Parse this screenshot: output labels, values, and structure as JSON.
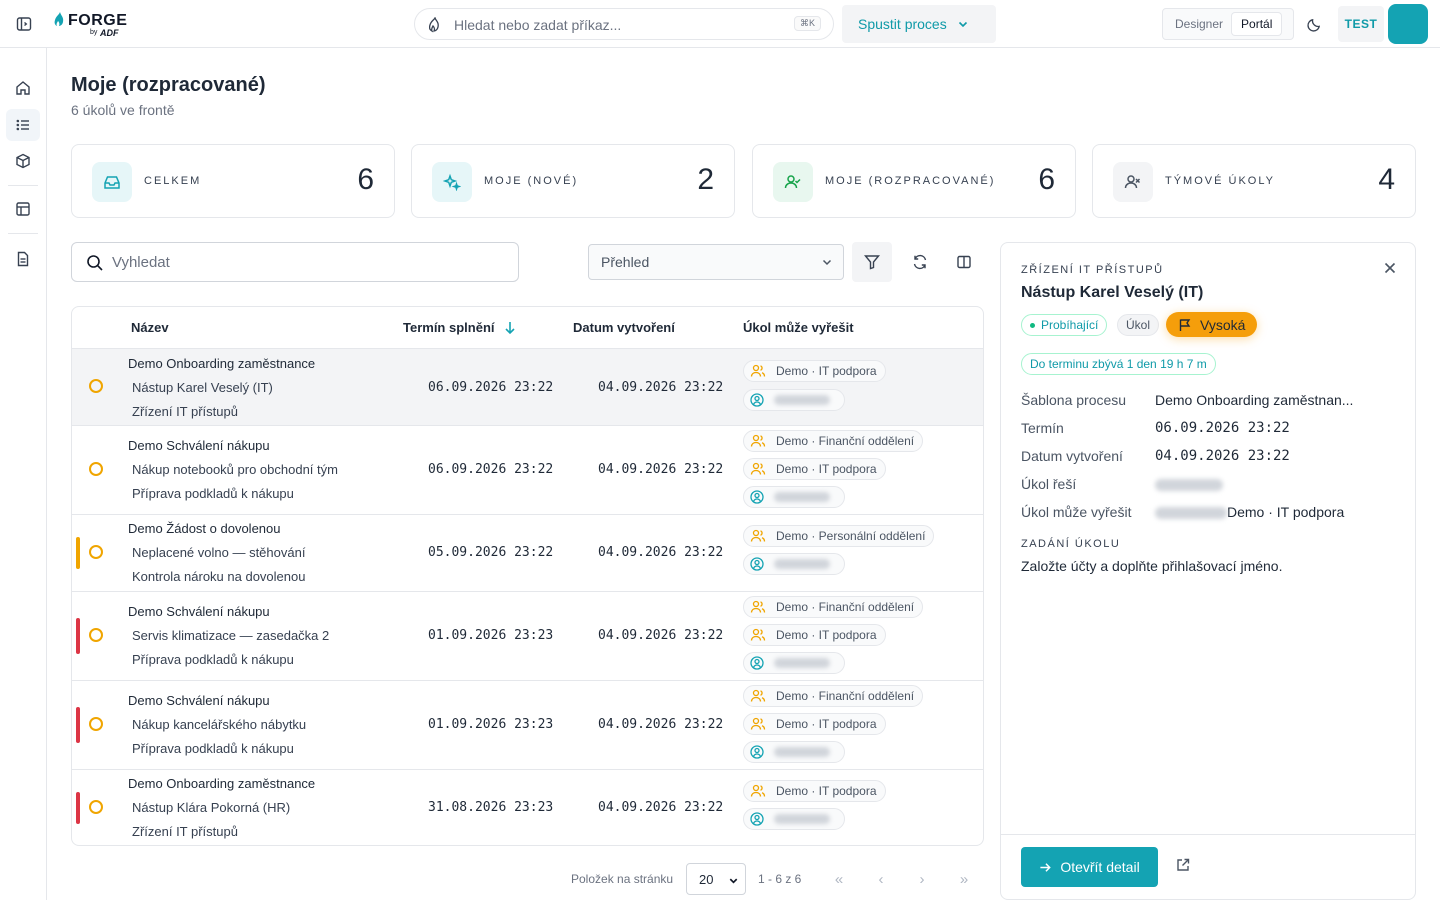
{
  "topbar": {
    "logo_name": "FORGE",
    "logo_by": "by",
    "logo_sub": "ADF",
    "search_placeholder": "Hledat nebo zadat příkaz...",
    "search_shortcut": "⌘K",
    "run_process_label": "Spustit proces",
    "modes": [
      "Designer",
      "Portál"
    ],
    "active_mode": "Portál",
    "environment": "TEST",
    "accent_color": "#14a3b3"
  },
  "page": {
    "title": "Moje (rozpracované)",
    "subtitle": "6 úkolů ve frontě"
  },
  "stats": [
    {
      "label": "CELKEM",
      "value": "6",
      "icon": "inbox-icon"
    },
    {
      "label": "MOJE (NOVÉ)",
      "value": "2",
      "icon": "sparkles-icon"
    },
    {
      "label": "MOJE (ROZPRACOVANÉ)",
      "value": "6",
      "icon": "user-check-icon"
    },
    {
      "label": "TÝMOVÉ ÚKOLY",
      "value": "4",
      "icon": "user-x-icon"
    }
  ],
  "toolbar": {
    "search_placeholder": "Vyhledat",
    "view_value": "Přehled"
  },
  "table": {
    "columns": [
      "Název",
      "Termín splnění",
      "Datum vytvoření",
      "Úkol může vyřešit"
    ],
    "rows": [
      {
        "process": "Demo Onboarding zaměstnance",
        "instance": "Nástup Karel Veselý (IT)",
        "step": "Zřízení IT přístupů",
        "due": "06.09.2026 23:22",
        "created": "04.09.2026 23:22",
        "groups": [
          "Demo · IT podpora"
        ],
        "priority": "none",
        "selected": true
      },
      {
        "process": "Demo Schválení nákupu",
        "instance": "Nákup notebooků pro obchodní tým",
        "step": "Příprava podkladů k nákupu",
        "due": "06.09.2026 23:22",
        "created": "04.09.2026 23:22",
        "groups": [
          "Demo · Finanční oddělení",
          "Demo · IT podpora"
        ],
        "priority": "none",
        "selected": false
      },
      {
        "process": "Demo Žádost o dovolenou",
        "instance": "Neplacené volno — stěhování",
        "step": "Kontrola nároku na dovolenou",
        "due": "05.09.2026 23:22",
        "created": "04.09.2026 23:22",
        "groups": [
          "Demo · Personální oddělení"
        ],
        "priority": "medium",
        "selected": false
      },
      {
        "process": "Demo Schválení nákupu",
        "instance": "Servis klimatizace — zasedačka 2",
        "step": "Příprava podkladů k nákupu",
        "due": "01.09.2026 23:23",
        "created": "04.09.2026 23:22",
        "groups": [
          "Demo · Finanční oddělení",
          "Demo · IT podpora"
        ],
        "priority": "high",
        "selected": false
      },
      {
        "process": "Demo Schválení nákupu",
        "instance": "Nákup kancelářského nábytku",
        "step": "Příprava podkladů k nákupu",
        "due": "01.09.2026 23:23",
        "created": "04.09.2026 23:22",
        "groups": [
          "Demo · Finanční oddělení",
          "Demo · IT podpora"
        ],
        "priority": "high",
        "selected": false
      },
      {
        "process": "Demo Onboarding zaměstnance",
        "instance": "Nástup Klára Pokorná (HR)",
        "step": "Zřízení IT přístupů",
        "due": "31.08.2026 23:23",
        "created": "04.09.2026 23:22",
        "groups": [
          "Demo · IT podpora"
        ],
        "priority": "high",
        "selected": false
      }
    ]
  },
  "pagination": {
    "per_page_label": "Položek na stránku",
    "per_page_value": "20",
    "range": "1 - 6 z 6"
  },
  "detail": {
    "kicker": "ZŘÍZENÍ IT PŘÍSTUPŮ",
    "title": "Nástup Karel Veselý (IT)",
    "status": "Probíhající",
    "type": "Úkol",
    "priority": "Vysoká",
    "deadline": "Do terminu zbývá 1 den 19 h 7 m",
    "fields": {
      "template_label": "Šablona procesu",
      "template_value": "Demo Onboarding zaměstnan...",
      "due_label": "Termín",
      "due_value": "06.09.2026 23:22",
      "created_label": "Datum vytvoření",
      "created_value": "04.09.2026 23:22",
      "assignee_label": "Úkol řeší",
      "resolver_label": "Úkol může vyřešit",
      "resolver_value": "Demo · IT podpora"
    },
    "section_label": "ZADÁNÍ ÚKOLU",
    "description": "Založte účty a doplňte přihlašovací jméno.",
    "open_button": "Otevřít detail"
  },
  "colors": {
    "accent": "#14a3b3",
    "priority_high": "#dc3545",
    "priority_medium": "#f0a500",
    "status_ring": "#f0a500"
  }
}
